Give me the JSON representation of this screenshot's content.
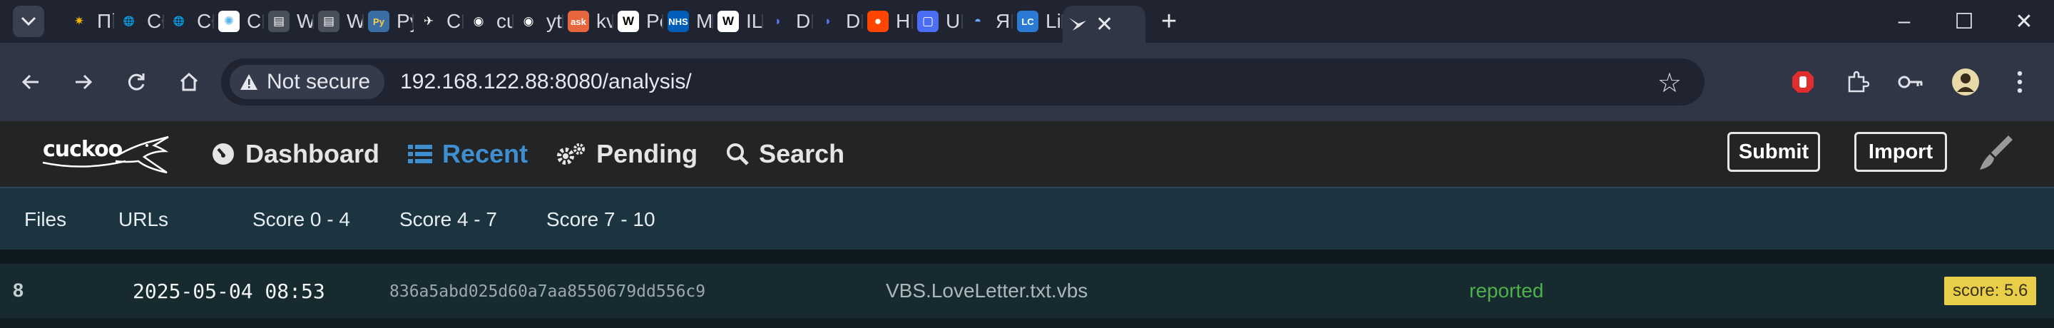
{
  "browser": {
    "tabs": [
      {
        "title": "Пі",
        "favicon": "sun-burst-icon",
        "fav_color": "#f4b400",
        "fav_bg": "transparent",
        "glyph": "✷"
      },
      {
        "title": "CC",
        "favicon": "globe-icon",
        "fav_color": "#cfd3da",
        "fav_bg": "transparent",
        "glyph": "🌐"
      },
      {
        "title": "CC",
        "favicon": "globe-icon",
        "fav_color": "#cfd3da",
        "fav_bg": "transparent",
        "glyph": "🌐"
      },
      {
        "title": "Cu",
        "favicon": "gear-badge-icon",
        "fav_color": "#5ab4e6",
        "fav_bg": "#ffffff",
        "glyph": "✺"
      },
      {
        "title": "W",
        "favicon": "book-icon",
        "fav_color": "#ffffff",
        "fav_bg": "#4a4f5c",
        "glyph": "▤"
      },
      {
        "title": "W",
        "favicon": "book-icon",
        "fav_color": "#ffffff",
        "fav_bg": "#4a4f5c",
        "glyph": "▤"
      },
      {
        "title": "Py",
        "favicon": "python-icon",
        "fav_color": "#f7d048",
        "fav_bg": "#3b6ea5",
        "glyph": "Py"
      },
      {
        "title": "Cu",
        "favicon": "cuckoo-bird-icon",
        "fav_color": "#ffffff",
        "fav_bg": "transparent",
        "glyph": "✈"
      },
      {
        "title": "cu",
        "favicon": "github-icon",
        "fav_color": "#ffffff",
        "fav_bg": "transparent",
        "glyph": "◉"
      },
      {
        "title": "yt",
        "favicon": "github-icon",
        "fav_color": "#ffffff",
        "fav_bg": "transparent",
        "glyph": "◉"
      },
      {
        "title": "kv",
        "favicon": "ask-icon",
        "fav_color": "#ffffff",
        "fav_bg": "#e8663d",
        "glyph": "ask"
      },
      {
        "title": "Pe",
        "favicon": "wikipedia-icon",
        "fav_color": "#000000",
        "fav_bg": "#ffffff",
        "glyph": "W"
      },
      {
        "title": "M",
        "favicon": "nhs-icon",
        "fav_color": "#ffffff",
        "fav_bg": "#005eb8",
        "glyph": "NHS"
      },
      {
        "title": "IL",
        "favicon": "wikipedia-icon",
        "fav_color": "#000000",
        "fav_bg": "#ffffff",
        "glyph": "W"
      },
      {
        "title": "D",
        "favicon": "deepseek-icon",
        "fav_color": "#5b7cf0",
        "fav_bg": "transparent",
        "glyph": "◗"
      },
      {
        "title": "D",
        "favicon": "deepseek-icon",
        "fav_color": "#5b7cf0",
        "fav_bg": "transparent",
        "glyph": "◗"
      },
      {
        "title": "H",
        "favicon": "reddit-icon",
        "fav_color": "#ffffff",
        "fav_bg": "#ff4500",
        "glyph": "●"
      },
      {
        "title": "U",
        "favicon": "chat-icon",
        "fav_color": "#ffffff",
        "fav_bg": "#4c6ef5",
        "glyph": "▢"
      },
      {
        "title": "Я",
        "favicon": "planet-icon",
        "fav_color": "#6fa8ff",
        "fav_bg": "transparent",
        "glyph": "◓"
      },
      {
        "title": "Li",
        "favicon": "lc-icon",
        "fav_color": "#ffffff",
        "fav_bg": "#2b7bd4",
        "glyph": "LC"
      }
    ],
    "active_tab": {
      "favicon": "cuckoo-bird-icon",
      "close": "✕"
    },
    "new_tab": "+",
    "window_controls": [
      "–",
      "☐",
      "✕"
    ],
    "security_label": "Not secure",
    "url": "192.168.122.88:8080/analysis/"
  },
  "app": {
    "logo_text": "cuckoo",
    "nav": [
      {
        "label": "Dashboard",
        "icon": "dashboard-gauge-icon"
      },
      {
        "label": "Recent",
        "icon": "list-icon",
        "active": true
      },
      {
        "label": "Pending",
        "icon": "cogs-icon"
      },
      {
        "label": "Search",
        "icon": "search-icon"
      }
    ],
    "submit_label": "Submit",
    "import_label": "Import",
    "accent_color": "#3f8ecf"
  },
  "filters": [
    "Files",
    "URLs",
    "Score 0 - 4",
    "Score 4 - 7",
    "Score 7 - 10"
  ],
  "rows": [
    {
      "id": "8",
      "date": "2025-05-04 08:53",
      "md5": "836a5abd025d60a7aa8550679dd556c9",
      "filename": "VBS.LoveLetter.txt.vbs",
      "status": "reported",
      "score": "score: 5.6"
    }
  ]
}
